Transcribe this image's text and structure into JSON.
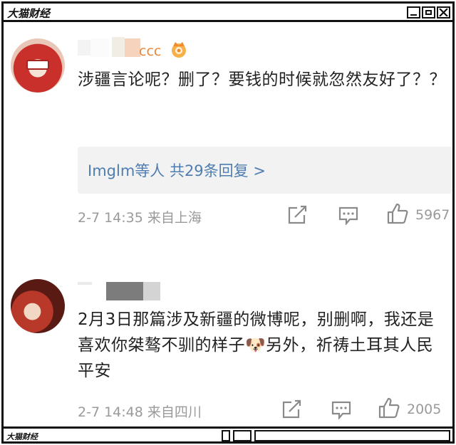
{
  "window": {
    "title": "大猫财经"
  },
  "statusbar": {
    "label": "大猫财经"
  },
  "comments": [
    {
      "username_suffix": "ccc",
      "text": "涉疆言论呢？删了？要钱的时候就忽然友好了？？",
      "replies_label": "Imglm等人 共29条回复 >",
      "time": "2-7 14:35 来自上海",
      "likes": "5967"
    },
    {
      "text": "2月3日那篇涉及新疆的微博呢，别删啊，我还是喜欢你桀骜不驯的样子🐶另外，祈祷土耳其人民平安",
      "time": "2-7 14:48 来自四川",
      "likes": "2005"
    }
  ],
  "icons": [
    "crown-icon",
    "share-icon",
    "comment-icon",
    "like-icon",
    "dog-emoji-icon",
    "minimize-icon",
    "maximize-icon",
    "close-icon"
  ],
  "colors": {
    "reply_link": "#4f7db0",
    "meta": "#9a9a9a",
    "username_vip": "#e8873a",
    "reply_bg": "#f2f2f2"
  }
}
